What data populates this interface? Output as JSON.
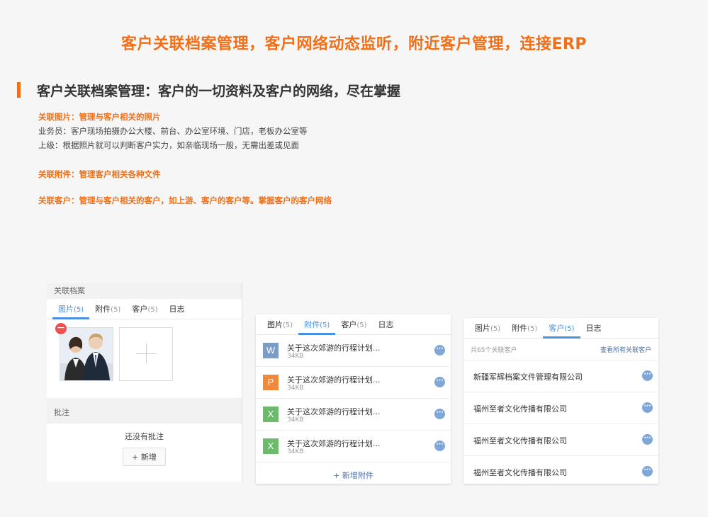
{
  "header": {
    "main_title": "客户关联档案管理，客户网络动态监听，附近客户管理，连接ERP",
    "section_title": "客户关联档案管理：客户的一切资料及客户的网络，尽在掌握"
  },
  "description": {
    "photos_heading": "关联图片：管理与客户相关的照片",
    "photos_line1": "业务员：客户现场拍摄办公大楼、前台、办公室环境、门店，老板办公室等",
    "photos_line2": "上级：根据照片就可以判断客户实力，如亲临现场一般，无需出差或见面",
    "attachments_heading": "关联附件：管理客户相关各种文件",
    "customers_heading": "关联客户：管理与客户相关的客户，如上游、客户的客户等。掌握客户的客户网络"
  },
  "panel1": {
    "title": "关联档案",
    "tabs": [
      {
        "label": "图片",
        "count": "(5)",
        "active": true
      },
      {
        "label": "附件",
        "count": "(5)",
        "active": false
      },
      {
        "label": "客户",
        "count": "(5)",
        "active": false
      },
      {
        "label": "日志",
        "count": "",
        "active": false
      }
    ],
    "notes_title": "批注",
    "empty_text": "还没有批注",
    "add_label": "+ 新增"
  },
  "panel2": {
    "tabs": [
      {
        "label": "图片",
        "count": "(5)",
        "active": false
      },
      {
        "label": "附件",
        "count": "(5)",
        "active": true
      },
      {
        "label": "客户",
        "count": "(5)",
        "active": false
      },
      {
        "label": "日志",
        "count": "",
        "active": false
      }
    ],
    "files": [
      {
        "icon": "W",
        "color": "#7a9cc6",
        "name": "关于这次郊游的行程计划...",
        "size": "34KB"
      },
      {
        "icon": "P",
        "color": "#f0893c",
        "name": "关于这次郊游的行程计划...",
        "size": "34KB"
      },
      {
        "icon": "X",
        "color": "#6cbb6c",
        "name": "关于这次郊游的行程计划...",
        "size": "34KB"
      },
      {
        "icon": "X",
        "color": "#6cbb6c",
        "name": "关于这次郊游的行程计划...",
        "size": "34KB"
      }
    ],
    "add_label": "+ 新增附件"
  },
  "panel3": {
    "tabs": [
      {
        "label": "图片",
        "count": "(5)",
        "active": false
      },
      {
        "label": "附件",
        "count": "(5)",
        "active": false
      },
      {
        "label": "客户",
        "count": "(5)",
        "active": true
      },
      {
        "label": "日志",
        "count": "",
        "active": false
      }
    ],
    "total": "共65个关联客户",
    "view_all": "查看所有关联客户",
    "customers": [
      "新疆军辉档案文件管理有限公司",
      "福州至者文化传播有限公司",
      "福州至者文化传播有限公司",
      "福州至者文化传播有限公司"
    ]
  },
  "colors": {
    "accent": "#f0701a",
    "tab_active": "#4a90e2",
    "more_button": "#7fa8d9"
  },
  "icons": {
    "more": "ellipsis-icon",
    "remove": "minus-icon",
    "add": "plus-icon"
  }
}
